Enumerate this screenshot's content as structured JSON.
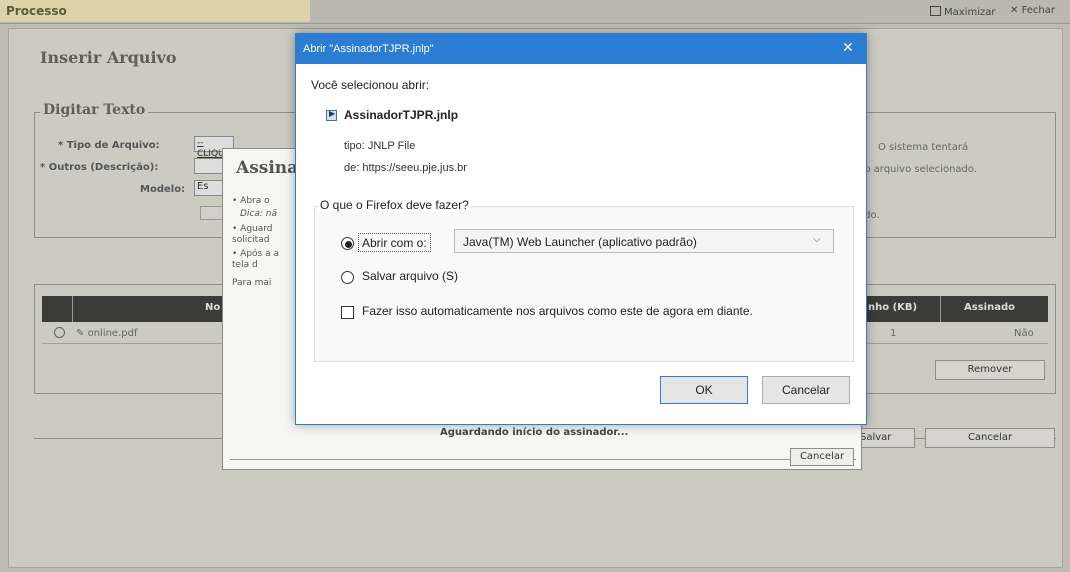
{
  "app": {
    "title": "Processo",
    "maximize_label": "Maximizar",
    "close_label": "Fechar"
  },
  "page": {
    "heading": "Inserir Arquivo",
    "section_title": "Digitar Texto",
    "fields": {
      "tipo_label": "* Tipo de Arquivo:",
      "tipo_value": "-- CLIQUE AQ",
      "outros_label": "* Outros (Descrição):",
      "modelo_label": "Modelo:",
      "modelo_value": "Es"
    },
    "right_text": {
      "line1": "O sistema tentará",
      "line2": "do arquivo selecionado.",
      "line3": "e",
      "line4": "ado."
    },
    "table": {
      "headers": [
        "No",
        "nho (KB)",
        "Assinado"
      ],
      "rows": [
        {
          "name": "online.pdf",
          "size": "1",
          "signed": "Não"
        }
      ]
    },
    "remover_label": "Remover",
    "salvar_label": "Salvar",
    "cancelar_label": "Cancelar"
  },
  "signer": {
    "title": "Assina",
    "bullets": [
      "Abra o",
      "Dica: nã",
      "Aguard solicitad",
      "Após a a tela d"
    ],
    "footer_text": "Para mai",
    "status": "Aguardando início do assinador...",
    "cancel_label": "Cancelar"
  },
  "dialog": {
    "title": "Abrir \"AssinadorTJPR.jnlp\"",
    "intro": "Você selecionou abrir:",
    "filename": "AssinadorTJPR.jnlp",
    "type_line": "tipo: JNLP File",
    "from_line": "de: https://seeu.pje.jus.br",
    "question": "O que o Firefox deve fazer?",
    "open_with_label": "Abrir com o:",
    "open_with_value": "Java(TM) Web Launcher (aplicativo padrão)",
    "save_label": "Salvar arquivo (S)",
    "auto_label": "Fazer isso automaticamente nos arquivos como este de agora em diante.",
    "ok_label": "OK",
    "cancel_label": "Cancelar",
    "close_glyph": "✕"
  },
  "colors": {
    "dialog_blue": "#2b7cd3",
    "accent_yellow": "#e8dca0"
  }
}
